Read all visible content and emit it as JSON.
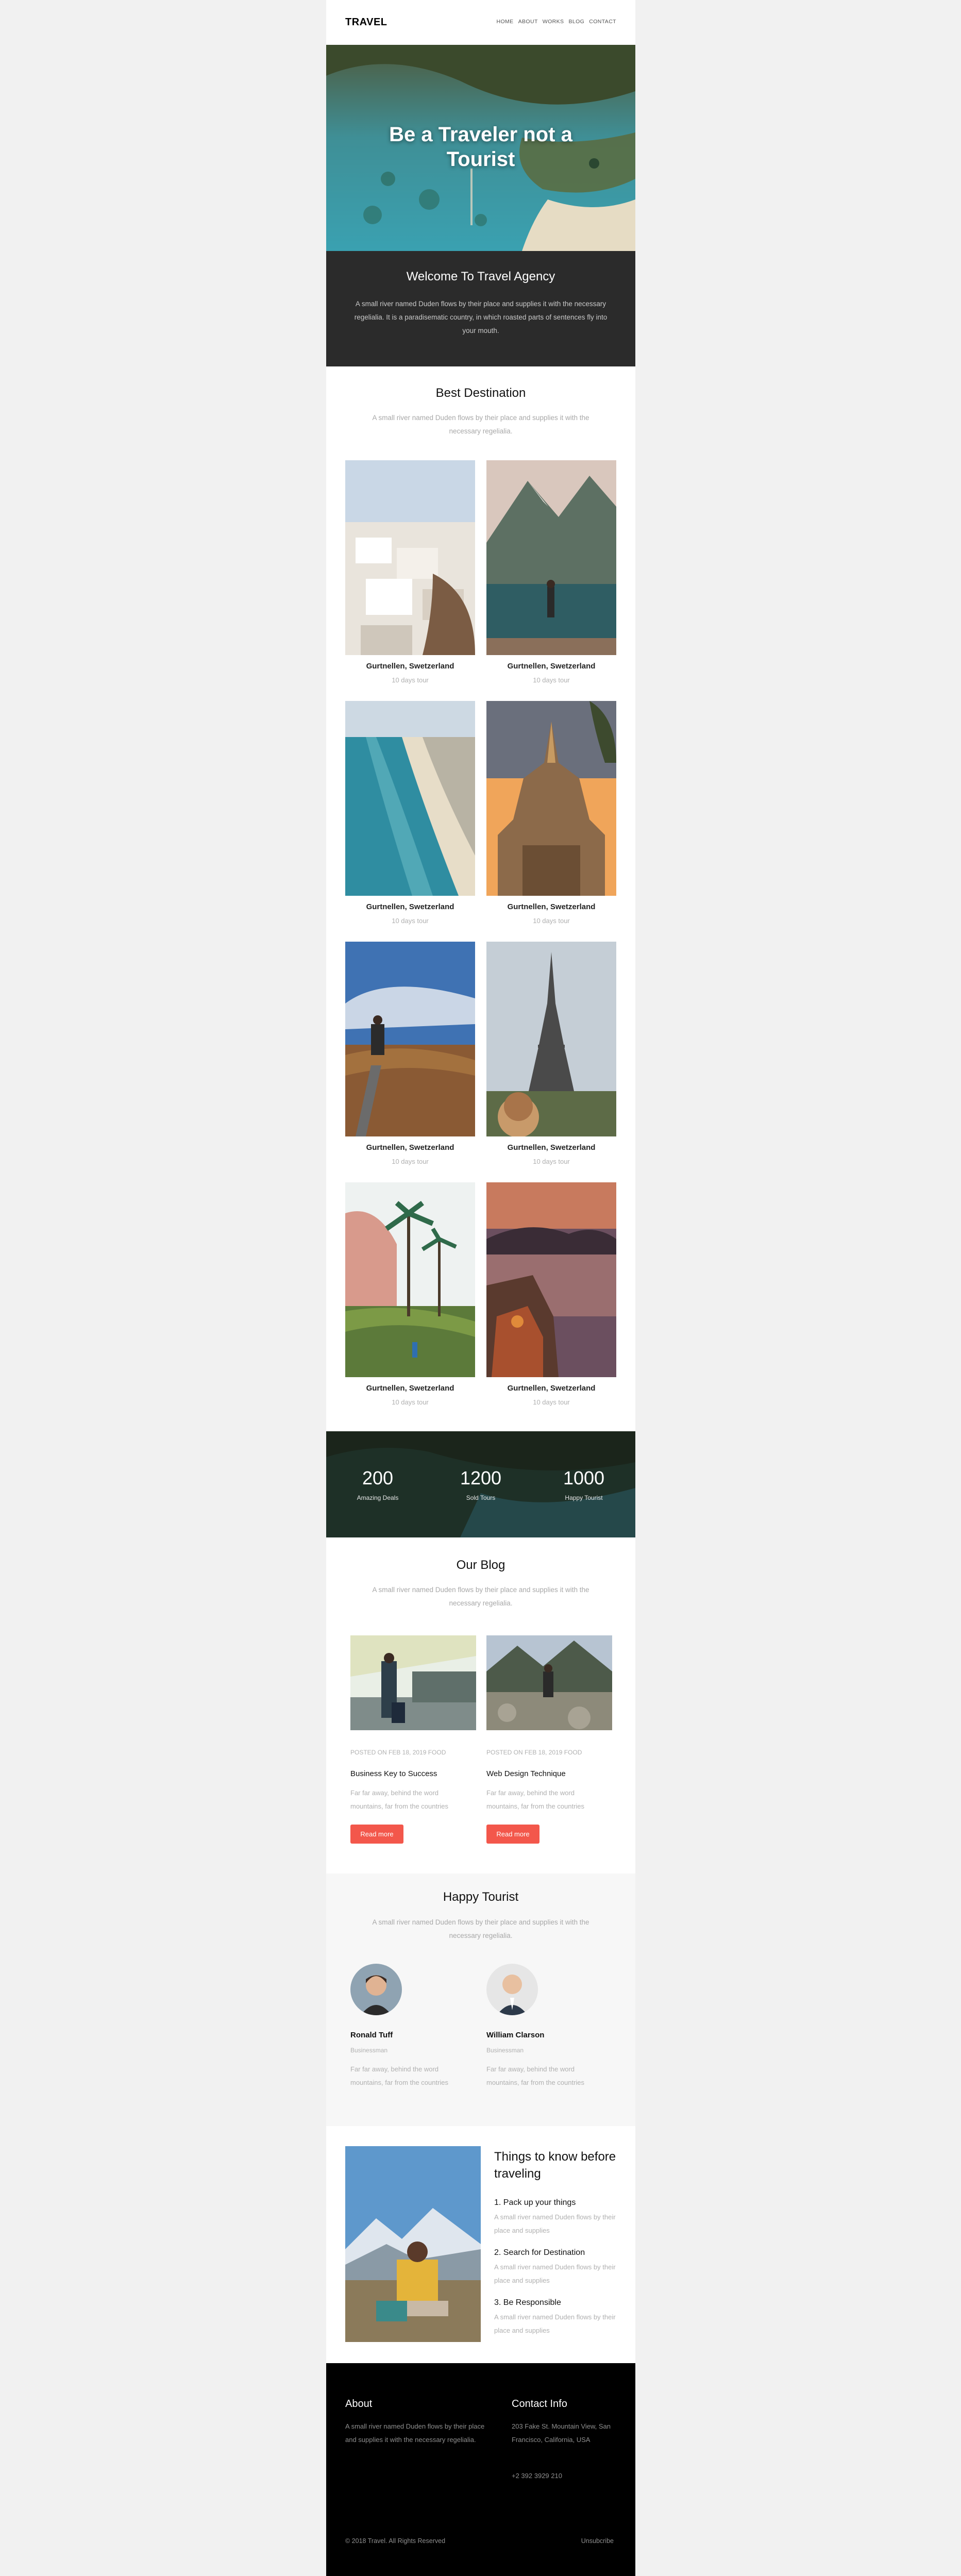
{
  "header": {
    "logo": "TRAVEL",
    "nav": [
      "HOME",
      "ABOUT",
      "WORKS",
      "BLOG",
      "CONTACT"
    ]
  },
  "hero": {
    "title": "Be a Traveler not a Tourist"
  },
  "welcome": {
    "title": "Welcome To Travel Agency",
    "text": "A small river named Duden flows by their place and supplies it with the necessary regelialia. It is a paradisematic country, in which roasted parts of sentences fly into your mouth."
  },
  "destinations": {
    "title": "Best Destination",
    "subtitle": "A small river named Duden flows by their place and supplies it with the necessary regelialia.",
    "items": [
      {
        "name": "Gurtnellen, Swetzerland",
        "sub": "10 days tour"
      },
      {
        "name": "Gurtnellen, Swetzerland",
        "sub": "10 days tour"
      },
      {
        "name": "Gurtnellen, Swetzerland",
        "sub": "10 days tour"
      },
      {
        "name": "Gurtnellen, Swetzerland",
        "sub": "10 days tour"
      },
      {
        "name": "Gurtnellen, Swetzerland",
        "sub": "10 days tour"
      },
      {
        "name": "Gurtnellen, Swetzerland",
        "sub": "10 days tour"
      },
      {
        "name": "Gurtnellen, Swetzerland",
        "sub": "10 days tour"
      },
      {
        "name": "Gurtnellen, Swetzerland",
        "sub": "10 days tour"
      }
    ]
  },
  "counters": [
    {
      "value": "200",
      "label": "Amazing Deals"
    },
    {
      "value": "1200",
      "label": "Sold Tours"
    },
    {
      "value": "1000",
      "label": "Happy Tourist"
    }
  ],
  "blog": {
    "title": "Our Blog",
    "subtitle": "A small river named Duden flows by their place and supplies it with the necessary regelialia.",
    "posts": [
      {
        "meta": "POSTED ON FEB 18, 2019 FOOD",
        "title": "Business Key to Success",
        "desc": "Far far away, behind the word mountains, far from the countries",
        "button": "Read more"
      },
      {
        "meta": "POSTED ON FEB 18, 2019 FOOD",
        "title": "Web Design Technique",
        "desc": "Far far away, behind the word mountains, far from the countries",
        "button": "Read more"
      }
    ]
  },
  "testimonials": {
    "title": "Happy Tourist",
    "subtitle": "A small river named Duden flows by their place and supplies it with the necessary regelialia.",
    "people": [
      {
        "name": "Ronald Tuff",
        "role": "Businessman",
        "text": "Far far away, behind the word mountains, far from the countries"
      },
      {
        "name": "William Clarson",
        "role": "Businessman",
        "text": "Far far away, behind the word mountains, far from the countries"
      }
    ]
  },
  "things": {
    "title": "Things to know before traveling",
    "steps": [
      {
        "title": "1. Pack up your things",
        "text": "A small river named Duden flows by their place and supplies"
      },
      {
        "title": "2. Search for Destination",
        "text": "A small river named Duden flows by their place and supplies"
      },
      {
        "title": "3. Be Responsible",
        "text": "A small river named Duden flows by their place and supplies"
      }
    ]
  },
  "footer": {
    "about_title": "About",
    "about_text": "A small river named Duden flows by their place and supplies it with the necessary regelialia.",
    "contact_title": "Contact Info",
    "address": "203 Fake St. Mountain View, San Francisco, California, USA",
    "phone": "+2 392 3929 210",
    "copyright": "© 2018 Travel. All Rights Reserved",
    "unsubscribe": "Unsubcribe"
  },
  "colors": {
    "accent": "#f3574b",
    "dark": "#2b2b2b",
    "footer": "#000000",
    "page_bg": "#f1f1f1"
  }
}
